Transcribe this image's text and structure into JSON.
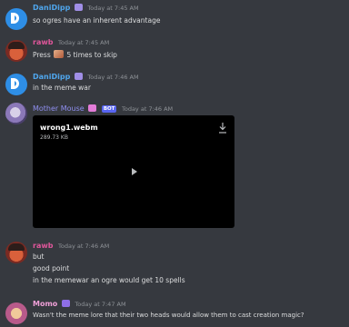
{
  "messages": [
    {
      "author": "DaniDipp",
      "author_color": "#4fa6ed",
      "timestamp": "Today at 7:45 AM",
      "lines": [
        "so ogres have an inherent advantage"
      ]
    },
    {
      "author": "rawb",
      "author_color": "#e0569b",
      "timestamp": "Today at 7:45 AM",
      "lines_parts": {
        "before": "Press",
        "after": "5 times to skip"
      }
    },
    {
      "author": "DaniDipp",
      "author_color": "#4fa6ed",
      "timestamp": "Today at 7:46 AM",
      "lines": [
        "in the meme war"
      ]
    },
    {
      "author": "Mother Mouse",
      "author_color": "#8f8ff0",
      "bot_tag": "BOT",
      "timestamp": "Today at 7:46 AM",
      "attachment": {
        "file_name": "wrong1.webm",
        "file_size": "289.73 KB"
      }
    },
    {
      "author": "rawb",
      "author_color": "#e0569b",
      "timestamp": "Today at 7:46 AM",
      "lines": [
        "but",
        "good point",
        "in the memewar an ogre would get 10 spells"
      ]
    },
    {
      "author": "Momo",
      "author_color": "#f0a0d8",
      "timestamp": "Today at 7:47 AM",
      "lines": [
        "Wasn't the meme lore that their two heads would allow them to cast creation magic?"
      ]
    }
  ],
  "icons": {
    "download": "download-icon",
    "play": "play-icon"
  }
}
